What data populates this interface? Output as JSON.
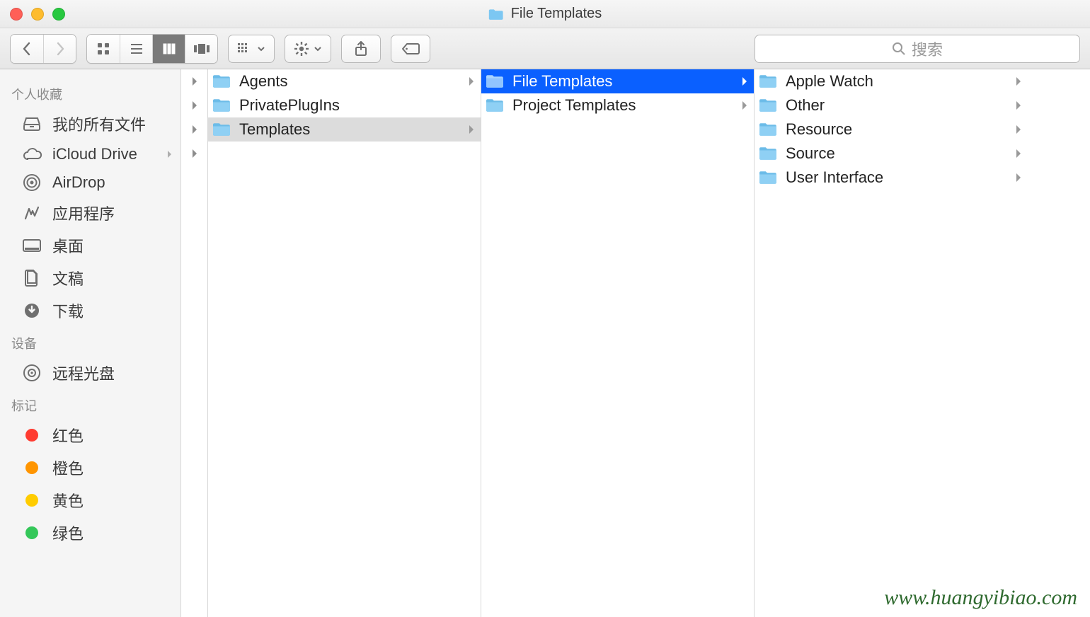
{
  "window": {
    "title": "File Templates"
  },
  "search": {
    "placeholder": "搜索"
  },
  "sidebar": {
    "sections": [
      {
        "title": "个人收藏",
        "items": [
          {
            "label": "我的所有文件",
            "icon": "all-files"
          },
          {
            "label": "iCloud Drive",
            "icon": "icloud",
            "expandable": true
          },
          {
            "label": "AirDrop",
            "icon": "airdrop"
          },
          {
            "label": "应用程序",
            "icon": "applications"
          },
          {
            "label": "桌面",
            "icon": "desktop"
          },
          {
            "label": "文稿",
            "icon": "documents"
          },
          {
            "label": "下载",
            "icon": "downloads"
          }
        ]
      },
      {
        "title": "设备",
        "items": [
          {
            "label": "远程光盘",
            "icon": "remote-disc"
          }
        ]
      },
      {
        "title": "标记",
        "items": [
          {
            "label": "红色",
            "color": "#ff3b30"
          },
          {
            "label": "橙色",
            "color": "#ff9500"
          },
          {
            "label": "黄色",
            "color": "#ffcc00"
          },
          {
            "label": "绿色",
            "color": "#34c759"
          }
        ]
      }
    ]
  },
  "columns": [
    {
      "items": [
        {
          "label": "Agents",
          "hasChildren": true
        },
        {
          "label": "PrivatePlugIns"
        },
        {
          "label": "Templates",
          "hasChildren": true,
          "selected": "gray"
        }
      ]
    },
    {
      "items": [
        {
          "label": "File Templates",
          "hasChildren": true,
          "selected": "blue"
        },
        {
          "label": "Project Templates",
          "hasChildren": true
        }
      ]
    },
    {
      "items": [
        {
          "label": "Apple Watch",
          "hasChildren": true
        },
        {
          "label": "Other",
          "hasChildren": true
        },
        {
          "label": "Resource",
          "hasChildren": true
        },
        {
          "label": "Source",
          "hasChildren": true
        },
        {
          "label": "User Interface",
          "hasChildren": true
        }
      ]
    }
  ],
  "watermark": "www.huangyibiao.com"
}
